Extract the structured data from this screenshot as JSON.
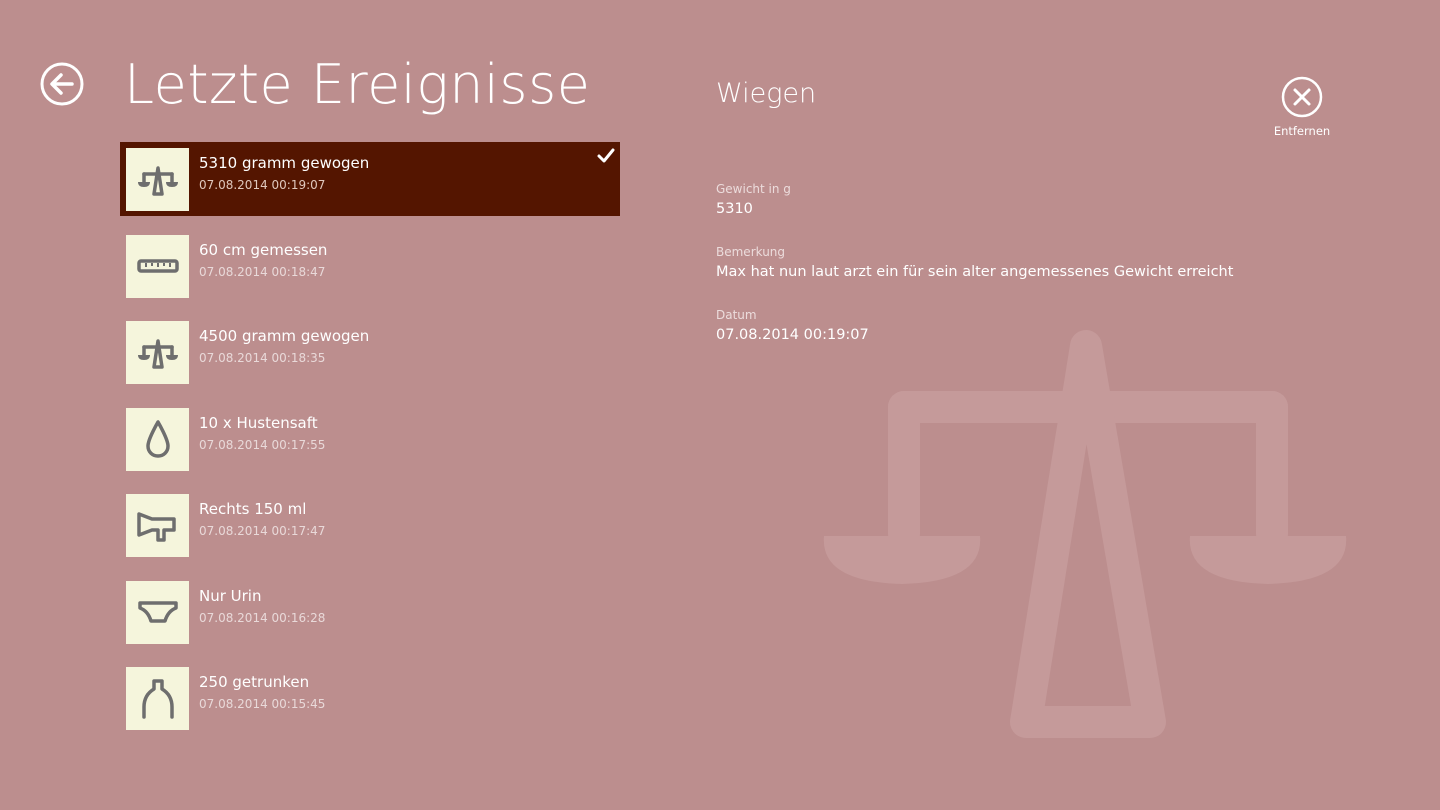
{
  "header": {
    "title": "Letzte Ereignisse"
  },
  "events": [
    {
      "title": "5310 gramm gewogen",
      "time": "07.08.2014 00:19:07",
      "icon": "scale-icon",
      "selected": true
    },
    {
      "title": "60 cm gemessen",
      "time": "07.08.2014 00:18:47",
      "icon": "ruler-icon",
      "selected": false
    },
    {
      "title": "4500 gramm gewogen",
      "time": "07.08.2014 00:18:35",
      "icon": "scale-icon",
      "selected": false
    },
    {
      "title": "10 x Hustensaft",
      "time": "07.08.2014 00:17:55",
      "icon": "drop-icon",
      "selected": false
    },
    {
      "title": "Rechts 150 ml",
      "time": "07.08.2014 00:17:47",
      "icon": "breast-pump-icon",
      "selected": false
    },
    {
      "title": "Nur Urin",
      "time": "07.08.2014 00:16:28",
      "icon": "diaper-icon",
      "selected": false
    },
    {
      "title": "250 getrunken",
      "time": "07.08.2014 00:15:45",
      "icon": "bottle-icon",
      "selected": false
    }
  ],
  "detail": {
    "title": "Wiegen",
    "fields": [
      {
        "label": "Gewicht in g",
        "value": "5310"
      },
      {
        "label": "Bemerkung",
        "value": "Max hat nun laut arzt ein für sein alter angemessenes Gewicht erreicht"
      },
      {
        "label": "Datum",
        "value": "07.08.2014 00:19:07"
      }
    ]
  },
  "actions": {
    "remove_label": "Entfernen"
  },
  "colors": {
    "background": "#bc8e8e",
    "selected_item": "#541500",
    "tile": "#f5f5dc",
    "icon_gray": "#6e6e6e"
  }
}
